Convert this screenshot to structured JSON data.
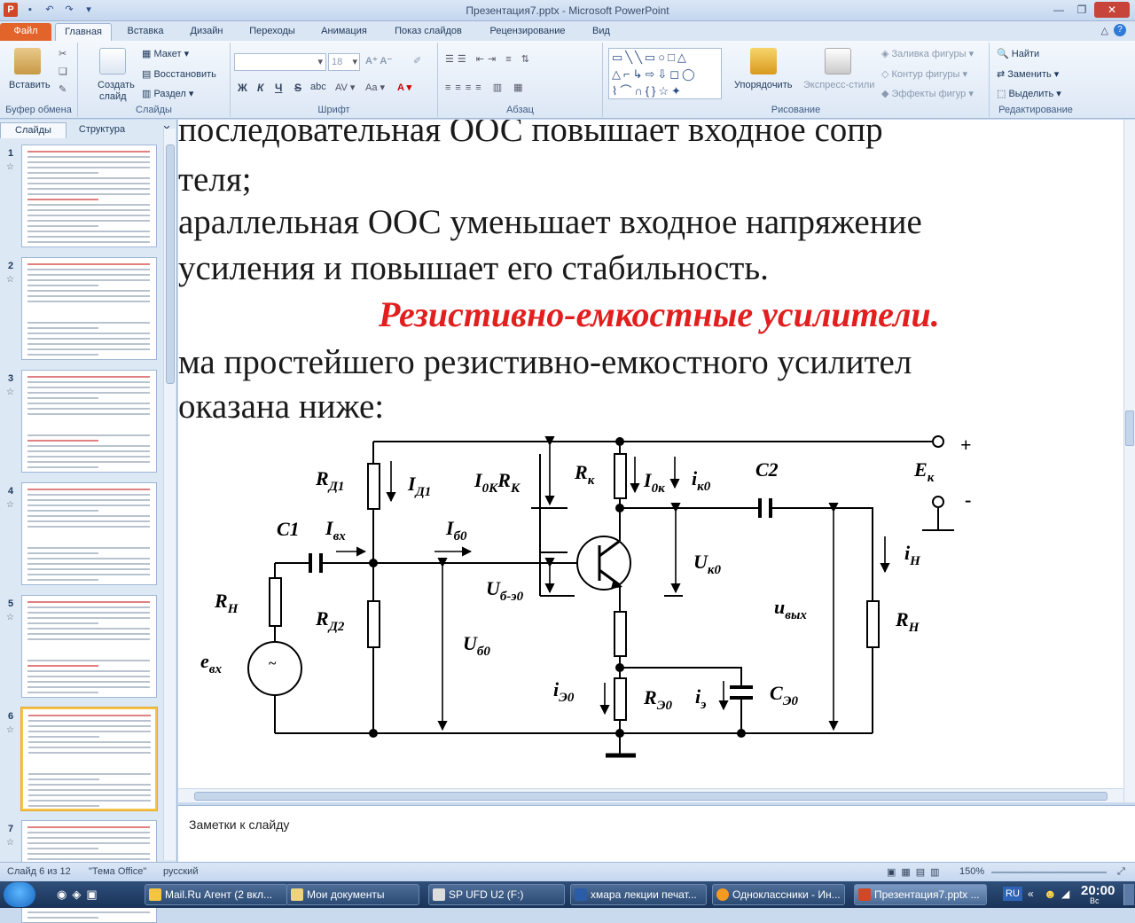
{
  "window": {
    "title": "Презентация7.pptx - Microsoft PowerPoint"
  },
  "tabs": [
    "Файл",
    "Главная",
    "Вставка",
    "Дизайн",
    "Переходы",
    "Анимация",
    "Показ слайдов",
    "Рецензирование",
    "Вид"
  ],
  "ribbon": {
    "clipboard": {
      "paste": "Вставить",
      "label": "Буфер обмена"
    },
    "slides": {
      "new_slide_1": "Создать",
      "new_slide_2": "слайд",
      "layout": "Макет",
      "reset": "Восстановить",
      "section": "Раздел",
      "label": "Слайды"
    },
    "font": {
      "font_size": "18",
      "label": "Шрифт",
      "bold": "Ж",
      "italic": "К",
      "underline": "Ч",
      "strike": "S",
      "shadow": "abc"
    },
    "paragraph": {
      "label": "Абзац"
    },
    "drawing": {
      "arrange": "Упорядочить",
      "quick_styles": "Экспресс-стили",
      "fill": "Заливка фигуры",
      "outline": "Контур фигуры",
      "effects": "Эффекты фигур",
      "label": "Рисование"
    },
    "editing": {
      "find": "Найти",
      "replace": "Заменить",
      "select": "Выделить",
      "label": "Редактирование"
    }
  },
  "sidebar": {
    "tab_slides": "Слайды",
    "tab_outline": "Структура",
    "slide_numbers": [
      "1",
      "2",
      "3",
      "4",
      "5",
      "6",
      "7"
    ],
    "selected": "6"
  },
  "slide": {
    "line1": "последовательная ООС повышает входное сопр",
    "line2": "теля;",
    "line3": "араллельная ООС уменьшает входное напряжение",
    "line4": "усиления и повышает его стабильность.",
    "title": "Резистивно-емкостные усилители.",
    "line5": "ма простейшего резистивно-емкостного усилител",
    "line6": "оказана ниже:"
  },
  "circuit": {
    "RD1": "R",
    "RD1s": "Д1",
    "ID1": "I",
    "ID1s": "Д1",
    "I0KRK": "I",
    "I0KRKs": "0К",
    "I0KRK2": "R",
    "I0KRK2s": "К",
    "RK": "R",
    "RKs": "к",
    "I0k": "I",
    "I0ks": "0к",
    "ik0": "i",
    "ik0s": "к0",
    "C2": "C2",
    "EK": "E",
    "EKs": "к",
    "plus": "+",
    "minus": "-",
    "C1": "C1",
    "Ivx": "I",
    "Ivxs": "вх",
    "Ib0": "I",
    "Ib0s": "б0",
    "Uk0": "U",
    "Uk0s": "к0",
    "iH": "i",
    "iHs": "Н",
    "RH_left": "R",
    "RH_lefts": "Н",
    "Ube0": "U",
    "Ube0s": "б-э0",
    "RD2": "R",
    "RD2s": "Д2",
    "uvyh": "u",
    "uvyhs": "вых",
    "RH_right": "R",
    "RH_rights": "Н",
    "evx": "e",
    "evxs": "вх",
    "Ub0": "U",
    "Ub0s": "б0",
    "iE0": "i",
    "iE0s": "Э0",
    "RE0": "R",
    "RE0s": "Э0",
    "iE": "i",
    "iEs": "э",
    "CE0": "C",
    "CE0s": "Э0",
    "tilde": "~"
  },
  "notes": {
    "placeholder": "Заметки к слайду"
  },
  "status": {
    "slide": "Слайд 6 из 12",
    "theme": "\"Тема Office\"",
    "lang": "русский",
    "zoom": "150%"
  },
  "taskbar": {
    "items": [
      "Mail.Ru Агент (2 вкл...",
      "Мои документы",
      "SP UFD U2 (F:)",
      "хмара лекции печат...",
      "Одноклассники - Ин...",
      "Презентация7.pptx ..."
    ],
    "lang": "RU",
    "time": "20:00",
    "day": "Вс"
  }
}
